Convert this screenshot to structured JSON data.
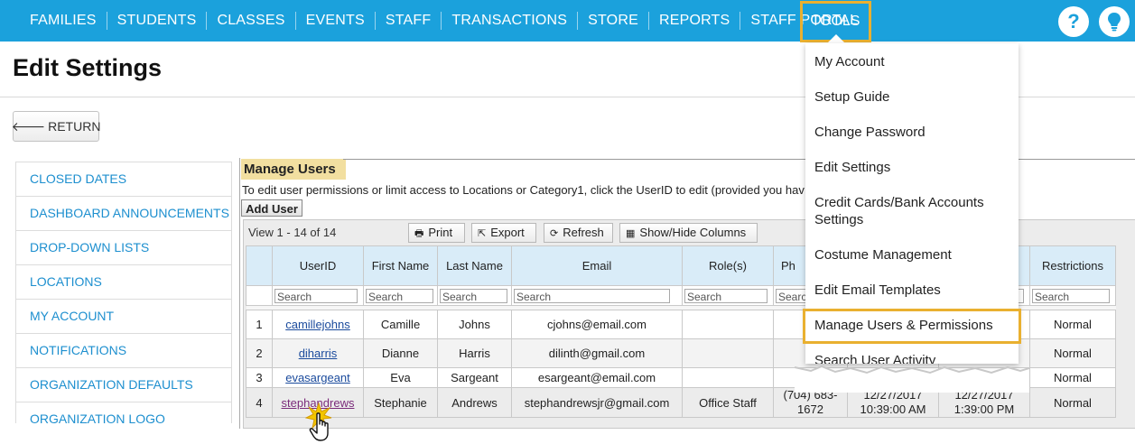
{
  "nav": {
    "items": [
      "FAMILIES",
      "STUDENTS",
      "CLASSES",
      "EVENTS",
      "STAFF",
      "TRANSACTIONS",
      "STORE",
      "REPORTS",
      "STAFF PORTAL"
    ],
    "active": "TOOLS",
    "help_glyph": "?",
    "bulb_glyph": "💡"
  },
  "page": {
    "title": "Edit Settings",
    "return_label": "RETURN"
  },
  "sidebar": {
    "items": [
      "CLOSED DATES",
      "DASHBOARD ANNOUNCEMENTS",
      "DROP-DOWN LISTS",
      "LOCATIONS",
      "MY ACCOUNT",
      "NOTIFICATIONS",
      "ORGANIZATION DEFAULTS",
      "ORGANIZATION LOGO"
    ]
  },
  "manage_users": {
    "title": "Manage Users",
    "description": "To edit user permissions or limit access to Locations or Category1, click the UserID to edit (provided you hav",
    "add_user": "Add User",
    "view_count": "View 1 - 14 of 14",
    "toolbar": {
      "print": "Print",
      "export": "Export",
      "refresh": "Refresh",
      "show_hide": "Show/Hide Columns"
    },
    "columns": [
      "UserID",
      "First Name",
      "Last Name",
      "Email",
      "Role(s)",
      "Ph",
      "",
      "",
      "Restrictions"
    ],
    "search_placeholder": "Search",
    "search_partial": "Searc",
    "rows": [
      {
        "num": "1",
        "userid": "camillejohns",
        "first": "Camille",
        "last": "Johns",
        "email": "cjohns@email.com",
        "role": "",
        "phone": "",
        "created": "",
        "modified": "",
        "restrictions": "Normal"
      },
      {
        "num": "2",
        "userid": "diharris",
        "first": "Dianne",
        "last": "Harris",
        "email": "dilinth@gmail.com",
        "role": "",
        "phone": "",
        "created": "",
        "modified": "",
        "restrictions": "Normal"
      },
      {
        "num": "3",
        "userid": "evasargeant",
        "first": "Eva",
        "last": "Sargeant",
        "email": "esargeant@email.com",
        "role": "",
        "phone": "",
        "created": "",
        "modified": "",
        "restrictions": "Normal"
      },
      {
        "num": "4",
        "userid": "stephandrews",
        "first": "Stephanie",
        "last": "Andrews",
        "email": "stephandrewsjr@gmail.com",
        "role": "Office Staff",
        "phone": "(704) 683-1672",
        "created": "12/27/2017 10:39:00 AM",
        "modified": "12/27/2017 1:39:00 PM",
        "restrictions": "Normal"
      }
    ]
  },
  "tools_menu": {
    "items": [
      "My Account",
      "Setup Guide",
      "Change Password",
      "Edit Settings",
      "Credit Cards/Bank Accounts Settings",
      "Costume Management",
      "Edit Email Templates"
    ],
    "highlighted": "Manage Users & Permissions",
    "partial": "Search User Activity"
  },
  "colors": {
    "nav_bg": "#1ba1dc",
    "highlight": "#e9b030",
    "link": "#1d8fcf",
    "header_bg": "#d9ecf8",
    "tab_bg": "#f2dfa0"
  }
}
